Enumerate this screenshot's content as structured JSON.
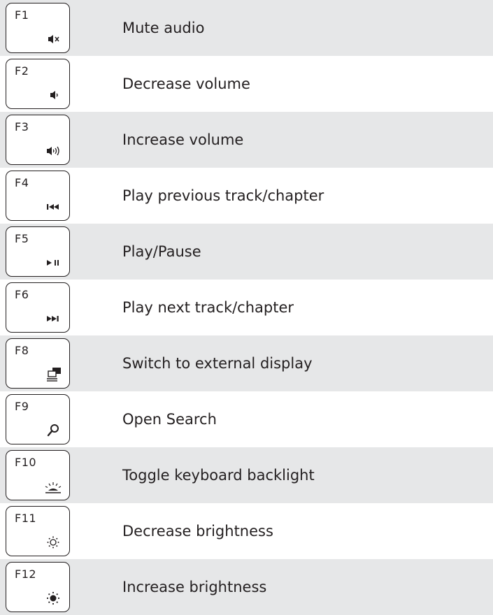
{
  "rows": [
    {
      "key": "F1",
      "icon": "mute-icon",
      "description": "Mute audio"
    },
    {
      "key": "F2",
      "icon": "volume-down-icon",
      "description": "Decrease volume"
    },
    {
      "key": "F3",
      "icon": "volume-up-icon",
      "description": "Increase volume"
    },
    {
      "key": "F4",
      "icon": "previous-track-icon",
      "description": "Play previous track/chapter"
    },
    {
      "key": "F5",
      "icon": "play-pause-icon",
      "description": "Play/Pause"
    },
    {
      "key": "F6",
      "icon": "next-track-icon",
      "description": "Play next track/chapter"
    },
    {
      "key": "F8",
      "icon": "external-display-icon",
      "description": "Switch to external display"
    },
    {
      "key": "F9",
      "icon": "search-icon",
      "description": "Open Search"
    },
    {
      "key": "F10",
      "icon": "keyboard-backlight-icon",
      "description": "Toggle keyboard backlight"
    },
    {
      "key": "F11",
      "icon": "brightness-down-icon",
      "description": "Decrease brightness"
    },
    {
      "key": "F12",
      "icon": "brightness-up-icon",
      "description": "Increase brightness"
    }
  ],
  "colors": {
    "shade": "#e6e7e8",
    "ink": "#231f20",
    "background": "#ffffff"
  }
}
